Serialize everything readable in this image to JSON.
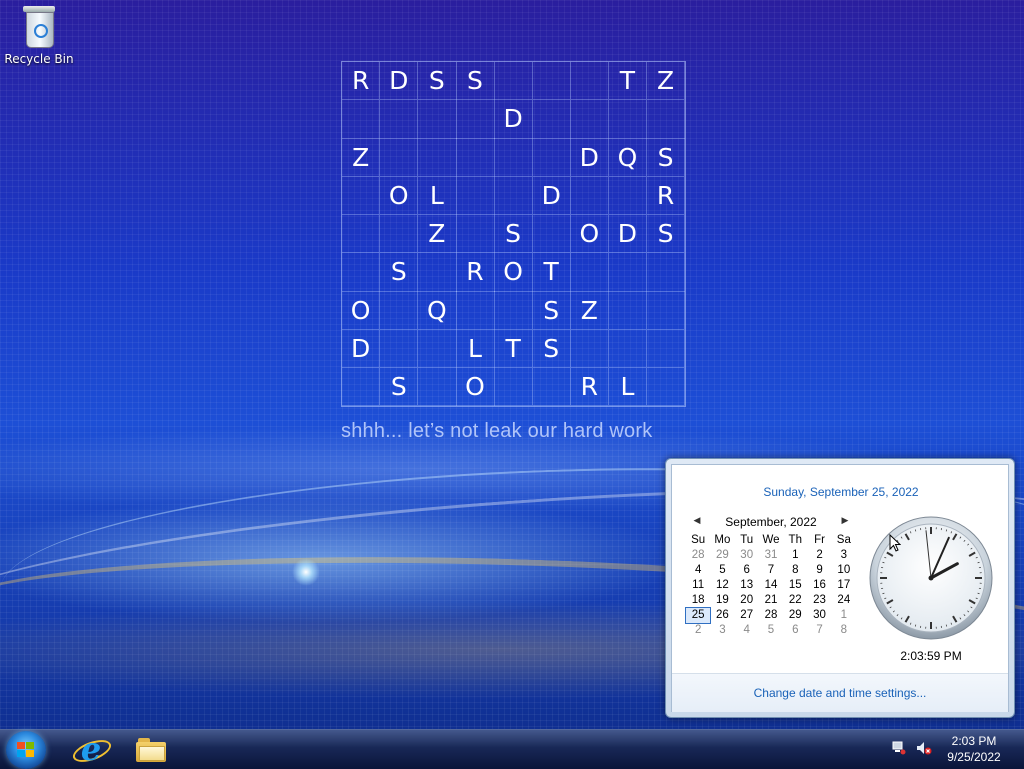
{
  "desktop": {
    "icons": [
      {
        "label": "Recycle Bin",
        "icon": "recycle-bin-icon"
      }
    ],
    "puzzle": {
      "rows": [
        [
          "R",
          "D",
          "S",
          "S",
          "",
          "",
          "",
          "T",
          "Z"
        ],
        [
          "",
          "",
          "",
          "",
          "D",
          "",
          "",
          "",
          ""
        ],
        [
          "Z",
          "",
          "",
          "",
          "",
          "",
          "D",
          "Q",
          "S"
        ],
        [
          "",
          "O",
          "L",
          "",
          "",
          "D",
          "",
          "",
          "R"
        ],
        [
          "",
          "",
          "Z",
          "",
          "S",
          "",
          "O",
          "D",
          "S"
        ],
        [
          "",
          "S",
          "",
          "R",
          "O",
          "T",
          "",
          "",
          ""
        ],
        [
          "O",
          "",
          "Q",
          "",
          "",
          "S",
          "Z",
          "",
          ""
        ],
        [
          "D",
          "",
          "",
          "L",
          "T",
          "S",
          "",
          "",
          ""
        ],
        [
          "",
          "S",
          "",
          "O",
          "",
          "",
          "R",
          "L",
          ""
        ]
      ],
      "caption": "shhh... let’s not leak our hard work"
    }
  },
  "flyout": {
    "full_date": "Sunday, September 25, 2022",
    "calendar": {
      "month_label": "September, 2022",
      "prev_icon": "chevron-left-icon",
      "next_icon": "chevron-right-icon",
      "weekdays": [
        "Su",
        "Mo",
        "Tu",
        "We",
        "Th",
        "Fr",
        "Sa"
      ],
      "weeks": [
        [
          {
            "d": "28",
            "o": true
          },
          {
            "d": "29",
            "o": true
          },
          {
            "d": "30",
            "o": true
          },
          {
            "d": "31",
            "o": true
          },
          {
            "d": "1"
          },
          {
            "d": "2"
          },
          {
            "d": "3"
          }
        ],
        [
          {
            "d": "4"
          },
          {
            "d": "5"
          },
          {
            "d": "6"
          },
          {
            "d": "7"
          },
          {
            "d": "8"
          },
          {
            "d": "9"
          },
          {
            "d": "10"
          }
        ],
        [
          {
            "d": "11"
          },
          {
            "d": "12"
          },
          {
            "d": "13"
          },
          {
            "d": "14"
          },
          {
            "d": "15"
          },
          {
            "d": "16"
          },
          {
            "d": "17"
          }
        ],
        [
          {
            "d": "18"
          },
          {
            "d": "19"
          },
          {
            "d": "20"
          },
          {
            "d": "21"
          },
          {
            "d": "22"
          },
          {
            "d": "23"
          },
          {
            "d": "24"
          }
        ],
        [
          {
            "d": "25",
            "today": true
          },
          {
            "d": "26"
          },
          {
            "d": "27"
          },
          {
            "d": "28"
          },
          {
            "d": "29"
          },
          {
            "d": "30"
          },
          {
            "d": "1",
            "o": true
          }
        ],
        [
          {
            "d": "2",
            "o": true
          },
          {
            "d": "3",
            "o": true
          },
          {
            "d": "4",
            "o": true
          },
          {
            "d": "5",
            "o": true
          },
          {
            "d": "6",
            "o": true
          },
          {
            "d": "7",
            "o": true
          },
          {
            "d": "8",
            "o": true
          }
        ]
      ]
    },
    "clock": {
      "time_text": "2:03:59 PM",
      "hours": 2,
      "minutes": 3,
      "seconds": 59
    },
    "settings_link": "Change date and time settings..."
  },
  "taskbar": {
    "start_icon": "windows-start-icon",
    "pinned": [
      {
        "name": "internet-explorer-icon"
      },
      {
        "name": "file-explorer-icon"
      }
    ],
    "tray": {
      "network_icon": "network-icon",
      "volume_icon": "volume-muted-icon",
      "time": "2:03 PM",
      "date": "9/25/2022"
    }
  },
  "colors": {
    "link": "#1a62b8",
    "desktop_blue": "#1d4fd6"
  }
}
